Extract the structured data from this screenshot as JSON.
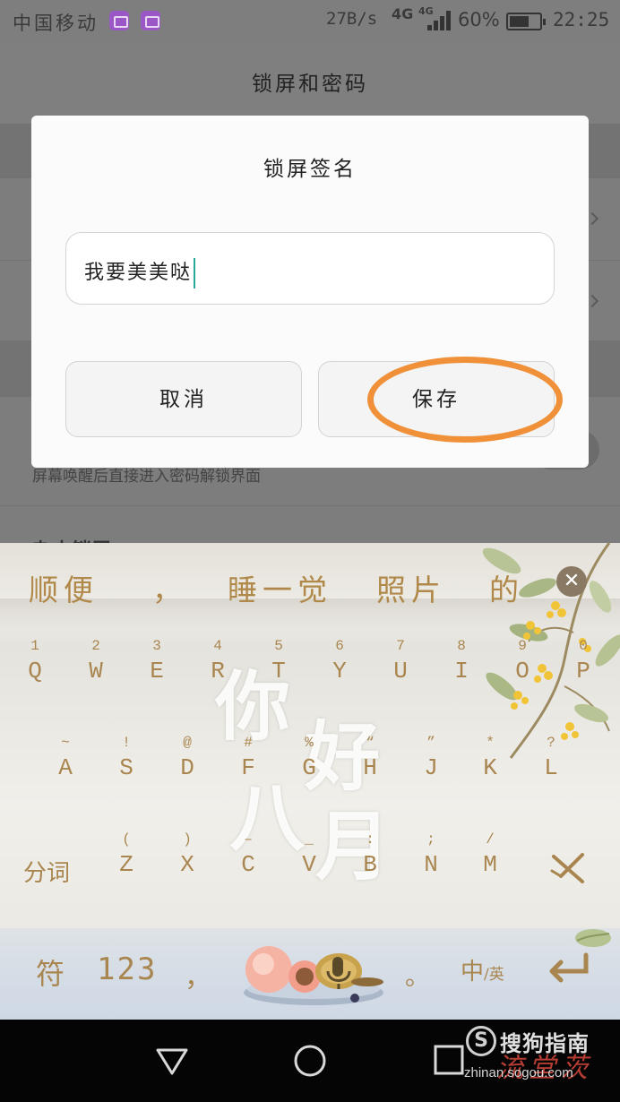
{
  "status_bar": {
    "carrier": "中国移动",
    "net_speed": "27B/s",
    "network_type_1": "4G",
    "network_type_2": "4G",
    "battery_percent": "60%",
    "time": "22:25"
  },
  "settings_page": {
    "title": "锁屏和密码",
    "partial_row_text": "屏幕唤醒后直接进入密码解锁界面",
    "partial_row_text_2": "杂志锁屏"
  },
  "dialog": {
    "title": "锁屏签名",
    "input_value": "我要美美哒",
    "cancel_label": "取消",
    "save_label": "保存"
  },
  "keyboard": {
    "candidates": [
      "顺便",
      "，",
      "睡一觉",
      "照片",
      "的"
    ],
    "close_symbol": "✕",
    "row1": [
      {
        "main": "Q",
        "sub": "1"
      },
      {
        "main": "W",
        "sub": "2"
      },
      {
        "main": "E",
        "sub": "3"
      },
      {
        "main": "R",
        "sub": "4"
      },
      {
        "main": "T",
        "sub": "5"
      },
      {
        "main": "Y",
        "sub": "6"
      },
      {
        "main": "U",
        "sub": "7"
      },
      {
        "main": "I",
        "sub": "8"
      },
      {
        "main": "O",
        "sub": "9"
      },
      {
        "main": "P",
        "sub": "0"
      }
    ],
    "row2": [
      {
        "main": "A",
        "sub": "~"
      },
      {
        "main": "S",
        "sub": "!"
      },
      {
        "main": "D",
        "sub": "@"
      },
      {
        "main": "F",
        "sub": "#"
      },
      {
        "main": "G",
        "sub": "%"
      },
      {
        "main": "H",
        "sub": "“"
      },
      {
        "main": "J",
        "sub": "”"
      },
      {
        "main": "K",
        "sub": "*"
      },
      {
        "main": "L",
        "sub": "?"
      }
    ],
    "row3": [
      {
        "main": "Z",
        "sub": "("
      },
      {
        "main": "X",
        "sub": ")"
      },
      {
        "main": "C",
        "sub": "–"
      },
      {
        "main": "V",
        "sub": "_"
      },
      {
        "main": "B",
        "sub": ":"
      },
      {
        "main": "N",
        "sub": ";"
      },
      {
        "main": "M",
        "sub": "/"
      }
    ],
    "segment_label": "分词",
    "symbol_label": "符",
    "number_label": "123",
    "comma_label": "，",
    "period_label": "。",
    "lang_label_cn": "中",
    "lang_label_en": "/英",
    "theme_text": [
      "你",
      "好",
      "八",
      "月"
    ]
  },
  "watermark": {
    "brand": "搜狗指南",
    "url": "zhinan.sogou.com",
    "signature": "流堂茨"
  }
}
